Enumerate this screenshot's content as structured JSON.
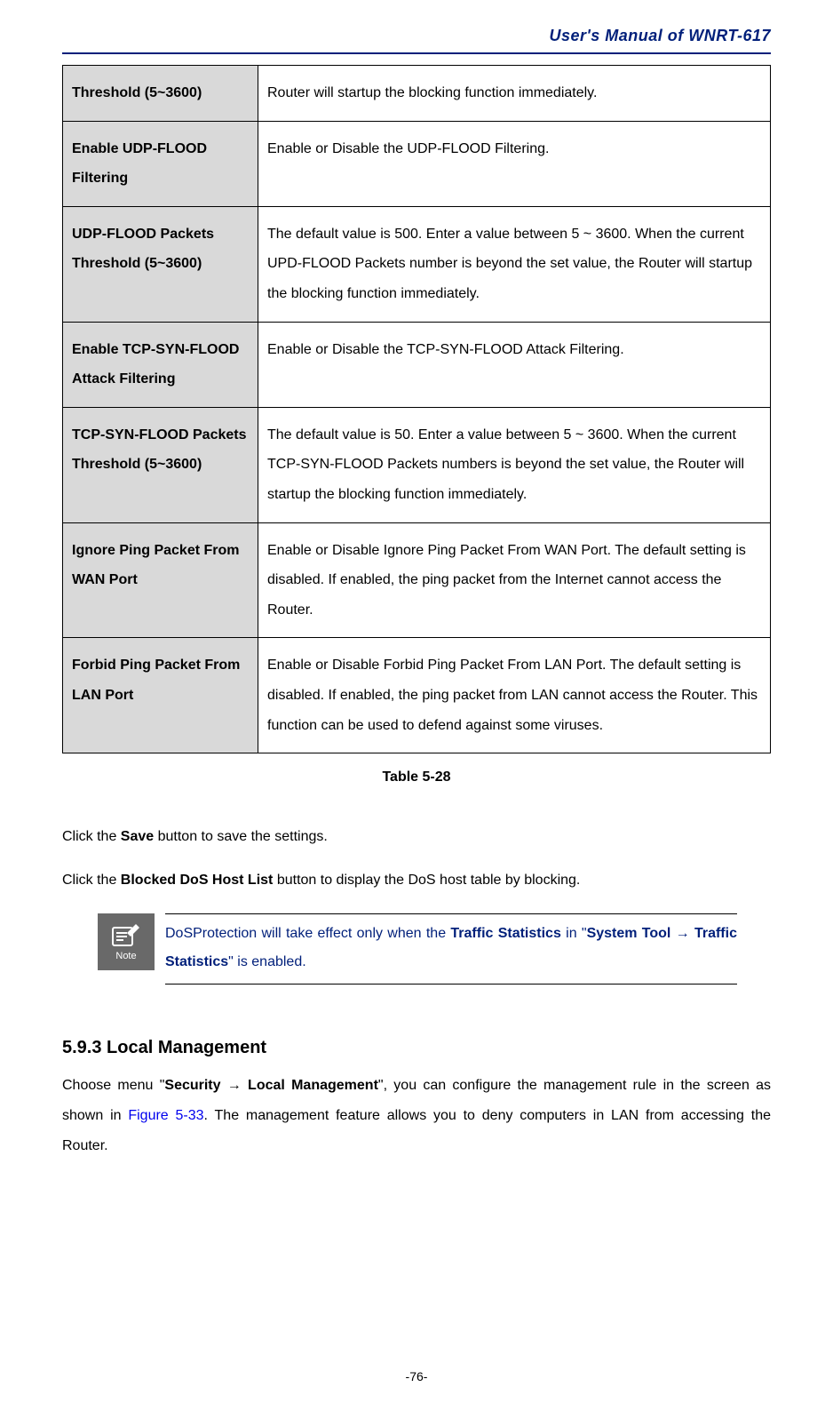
{
  "header": {
    "title": "User's Manual of WNRT-617"
  },
  "table": {
    "rows": [
      {
        "label": "Threshold (5~3600)",
        "desc": "Router will startup the blocking function immediately."
      },
      {
        "label": "Enable UDP-FLOOD Filtering",
        "desc": "Enable or Disable the UDP-FLOOD Filtering."
      },
      {
        "label": "UDP-FLOOD Packets Threshold (5~3600)",
        "desc": "The default value is 500. Enter a value between 5 ~ 3600. When the current UPD-FLOOD Packets number is beyond the set value, the Router will startup the blocking function immediately."
      },
      {
        "label": "Enable TCP-SYN-FLOOD Attack Filtering",
        "desc": "Enable or Disable the TCP-SYN-FLOOD Attack Filtering."
      },
      {
        "label": "TCP-SYN-FLOOD Packets Threshold (5~3600)",
        "desc": "The default value is 50. Enter a value between 5 ~ 3600. When the current TCP-SYN-FLOOD Packets numbers is beyond the set value, the Router will startup the blocking function immediately."
      },
      {
        "label": "Ignore Ping Packet From WAN Port",
        "desc": "Enable or Disable Ignore Ping Packet From WAN Port. The default setting is disabled. If enabled, the ping packet from the Internet cannot access the Router."
      },
      {
        "label": "Forbid Ping Packet From LAN Port",
        "desc": "Enable or Disable Forbid Ping Packet From LAN Port. The default setting is disabled. If enabled, the ping packet from LAN cannot access the Router. This function can be used to defend against some viruses."
      }
    ],
    "caption": "Table 5-28"
  },
  "instructions": {
    "line1_pre": "Click the ",
    "line1_strong": "Save",
    "line1_post": " button to save the settings.",
    "line2_pre": "Click the ",
    "line2_strong": "Blocked DoS Host List",
    "line2_post": " button to display the DoS host table by blocking."
  },
  "note": {
    "icon_label": "Note",
    "text_pre": "DoSProtection will take effect only when the ",
    "strong1": "Traffic Statistics",
    "text_mid": " in \"",
    "strong2": "System Tool → Traffic Statistics",
    "text_post": "\" is enabled."
  },
  "section": {
    "heading": "5.9.3  Local Management",
    "body_pre": "Choose menu \"",
    "body_strong": "Security → Local Management",
    "body_mid": "\", you can configure the management rule in the screen as shown in ",
    "body_figref": "Figure 5-33",
    "body_post": ". The management feature allows you to deny computers in LAN from accessing the Router."
  },
  "footer": {
    "page_number": "-76-"
  }
}
